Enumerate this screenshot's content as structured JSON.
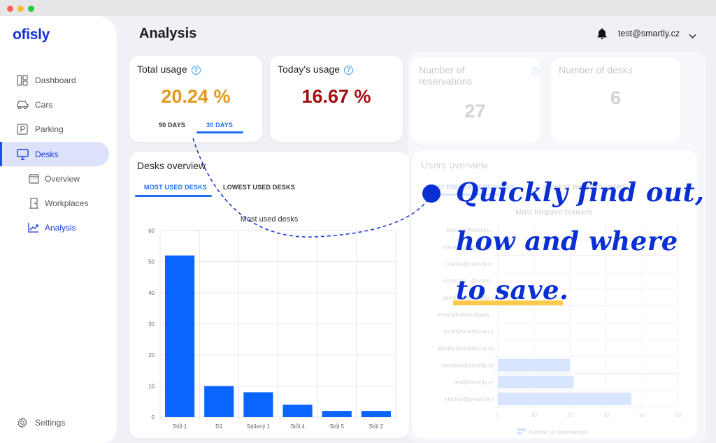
{
  "window": {
    "controls": [
      "close",
      "minimize",
      "maximize"
    ]
  },
  "sidebar": {
    "logo": "ofisly",
    "items": [
      {
        "label": "Dashboard",
        "icon": "dashboard-icon"
      },
      {
        "label": "Cars",
        "icon": "car-icon"
      },
      {
        "label": "Parking",
        "icon": "parking-icon"
      },
      {
        "label": "Desks",
        "icon": "monitor-icon",
        "active": true
      },
      {
        "label": "Overview",
        "icon": "calendar-icon",
        "sub": true
      },
      {
        "label": "Workplaces",
        "icon": "door-icon",
        "sub": true
      },
      {
        "label": "Analysis",
        "icon": "chart-line-icon",
        "sub": true,
        "current": true
      }
    ],
    "settings": "Settings"
  },
  "header": {
    "title": "Analysis",
    "user": "test@smartly.cz"
  },
  "cards": {
    "total_usage": {
      "title": "Total usage",
      "value": "20.24 %",
      "color": "#e09a1e",
      "tabs": [
        "90 DAYS",
        "30 DAYS"
      ],
      "active_tab": "30 DAYS"
    },
    "today_usage": {
      "title": "Today's usage",
      "value": "16.67 %",
      "color": "#a30f0f"
    },
    "reservations": {
      "title_line1": "Number of",
      "title_line2": "reservations",
      "value": "27"
    },
    "desks": {
      "title": "Number of desks",
      "value": "6"
    }
  },
  "desks_overview": {
    "title": "Desks overview",
    "tabs": [
      "MOST USED DESKS",
      "LOWEST USED DESKS"
    ],
    "active_tab": "MOST USED DESKS"
  },
  "users_overview": {
    "title": "Users overview",
    "tabs": [
      "MOST FREQUENT BOOKERS",
      "LOWEST BOOKING USERS"
    ]
  },
  "callout": {
    "line1": "Quickly find out,",
    "line2": "how and where",
    "line3": "to save."
  },
  "chart_data": [
    {
      "type": "bar",
      "title": "Most used desks",
      "categories": [
        "Stůl 1",
        "D1",
        "Sdílený 1",
        "Stůl 4",
        "Stůl 5",
        "Stůl 2"
      ],
      "values": [
        52,
        10,
        8,
        4,
        2,
        2
      ],
      "ylim": [
        0,
        60
      ],
      "yticks": [
        0,
        10,
        20,
        30,
        40,
        50,
        60
      ],
      "legend": "Number of reservations",
      "legend_position": "bottom",
      "color": "#0a64ff",
      "grid": true
    },
    {
      "type": "bar",
      "orientation": "horizontal",
      "title": "Most frequent bookers",
      "categories": [
        "bistudio@smartly...",
        "kleckafi@gmail.com",
        "klecka@outlook.cz",
        "knorr-bre...@smar...",
        "sberbank@smartly...",
        "smartlyforhelp@gma...",
        "ysoft@smartlycar.cz",
        "deloitte@smartlycar.cz",
        "slovacek@smartly.cz",
        "test@smartly.cz",
        "kleckaf@gmail.com"
      ],
      "values": [
        0,
        0,
        0,
        0,
        0,
        0,
        0,
        0,
        20,
        21,
        37
      ],
      "xlim": [
        0,
        50
      ],
      "xticks": [
        0,
        10,
        20,
        30,
        40,
        50
      ],
      "legend": "Number of reservations",
      "legend_position": "bottom",
      "color": "#c9dcff",
      "grid": true
    }
  ]
}
